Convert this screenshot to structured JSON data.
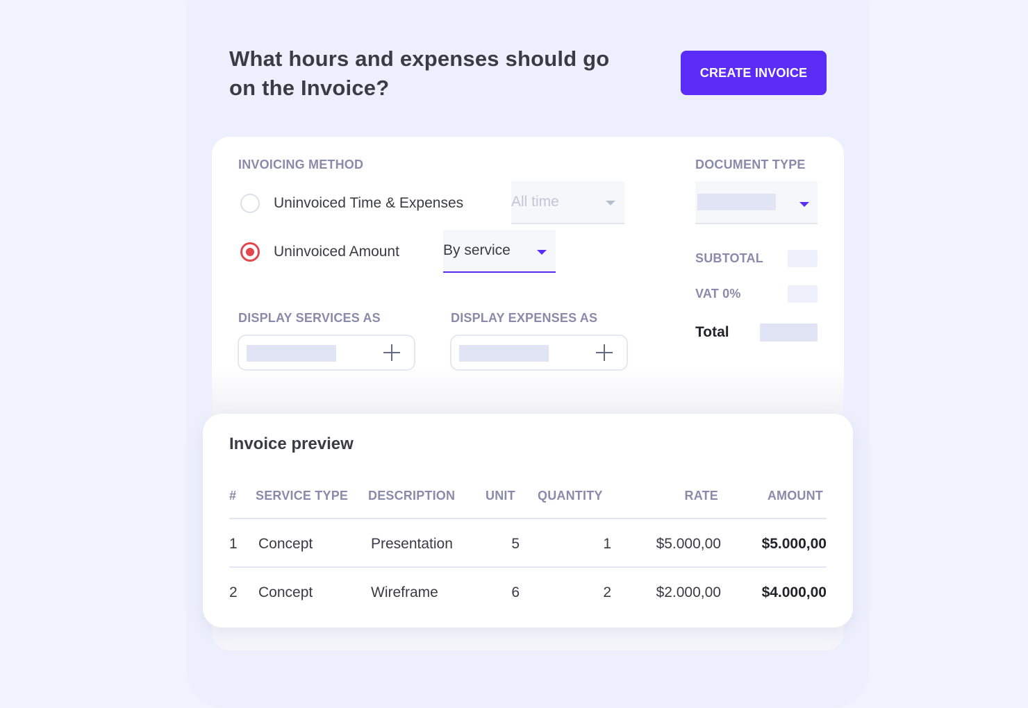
{
  "header": {
    "title": "What hours and expenses should go on the Invoice?",
    "create_button": "CREATE INVOICE"
  },
  "invoicing_method": {
    "label": "INVOICING METHOD",
    "options": [
      {
        "label": "Uninvoiced Time & Expenses",
        "selected": false,
        "period": "All time"
      },
      {
        "label": "Uninvoiced Amount",
        "selected": true,
        "grouping": "By service"
      }
    ]
  },
  "document_type": {
    "label": "DOCUMENT TYPE"
  },
  "display": {
    "services_label": "DISPLAY SERVICES AS",
    "expenses_label": "DISPLAY EXPENSES AS"
  },
  "summary": {
    "subtotal_label": "SUBTOTAL",
    "vat_label": "VAT 0%",
    "total_label": "Total"
  },
  "preview": {
    "title": "Invoice preview",
    "columns": [
      "#",
      "SERVICE TYPE",
      "DESCRIPTION",
      "UNIT",
      "QUANTITY",
      "RATE",
      "AMOUNT"
    ],
    "rows": [
      {
        "num": "1",
        "service_type": "Concept",
        "description": "Presentation",
        "unit": "5",
        "quantity": "1",
        "rate": "$5.000,00",
        "amount": "$5.000,00"
      },
      {
        "num": "2",
        "service_type": "Concept",
        "description": "Wireframe",
        "unit": "6",
        "quantity": "2",
        "rate": "$2.000,00",
        "amount": "$4.000,00"
      }
    ]
  },
  "colors": {
    "accent": "#5b2cf6",
    "radio_selected": "#e3474f",
    "background": "#f0f2fd"
  }
}
